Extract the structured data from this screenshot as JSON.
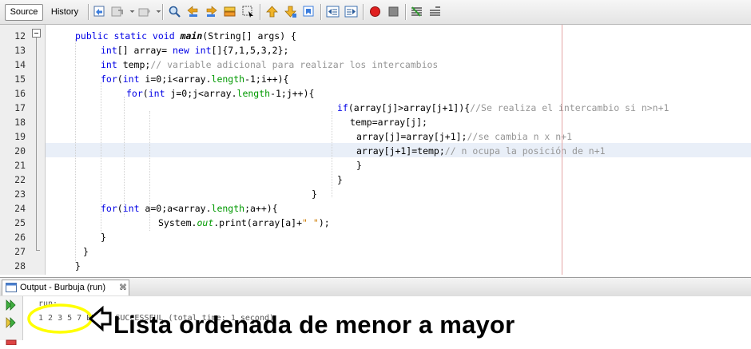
{
  "toolbar": {
    "source_tab": "Source",
    "history_tab": "History",
    "buttons": [
      "last-edit-icon",
      "back-icon",
      "forward-icon",
      "find-icon",
      "find-previous-icon",
      "find-next-icon",
      "toggle-highlight-icon",
      "find-selection-icon",
      "previous-bookmark-icon",
      "next-bookmark-icon",
      "toggle-bookmark-icon",
      "shift-left-icon",
      "shift-right-icon",
      "start-macro-icon",
      "stop-macro-icon",
      "comment-icon",
      "uncomment-icon"
    ]
  },
  "editor": {
    "line_numbers": [
      "12",
      "13",
      "14",
      "15",
      "16",
      "17",
      "18",
      "19",
      "20",
      "21",
      "22",
      "23",
      "24",
      "25",
      "26",
      "27",
      "28"
    ],
    "current_line": "20",
    "code": {
      "l12_kw": "public static void ",
      "l12_method": "main",
      "l12_rest": "(String[] args) {",
      "l13_kw1": "int",
      "l13_a": "[] array= ",
      "l13_kw2": "new int",
      "l13_b": "[]{7,1,5,3,2};",
      "l14_kw": "int",
      "l14_a": " temp;",
      "l14_cm": "// variable adicional para realizar los intercambios",
      "l15_kw": "for",
      "l15_a": "(",
      "l15_kw2": "int",
      "l15_b": " i=0;i<array.",
      "l15_field": "length",
      "l15_c": "-1;i++){",
      "l16_kw": "for",
      "l16_a": "(",
      "l16_kw2": "int",
      "l16_b": " j=0;j<array.",
      "l16_field": "length",
      "l16_c": "-1;j++){",
      "l17_kw": "if",
      "l17_a": "(array[j]>array[j+1]){",
      "l17_cm": "//Se realiza el intercambio si n>n+1",
      "l18": "temp=array[j];",
      "l19_a": "array[j]=array[j+1];",
      "l19_cm": "//se cambia n x n+1",
      "l20_a": "array[j+1]=temp;",
      "l20_cm": "// n ocupa la posición de n+1",
      "l21": "}",
      "l22": "}",
      "l23": "}",
      "l24_kw": "for",
      "l24_a": "(",
      "l24_kw2": "int",
      "l24_b": " a=0;a<array.",
      "l24_field": "length",
      "l24_c": ";a++){",
      "l25_a": "System.",
      "l25_field": "out",
      "l25_b": ".print(array[a]+",
      "l25_str": "\" \"",
      "l25_c": ");",
      "l26": "}",
      "l27": "}",
      "l28": "}"
    }
  },
  "output": {
    "tab_label": "Output - Burbuja (run)",
    "close_glyph": "⌘",
    "run_line": "run:",
    "result_line": "1 2 3 5 7 BUILD SUCCESSFUL (total time: 1 second)",
    "side_buttons": [
      "rerun-icon",
      "rerun-with-args-icon",
      "stop-icon"
    ]
  },
  "annotation": {
    "text": "Lista ordenada de menor a mayor",
    "color": "#ffff00"
  },
  "colors": {
    "keyword": "#0000e6",
    "comment": "#969696",
    "string": "#ce7b00",
    "field": "#009900",
    "current_line": "#e9eff8",
    "right_margin": "#e4a5a5"
  }
}
